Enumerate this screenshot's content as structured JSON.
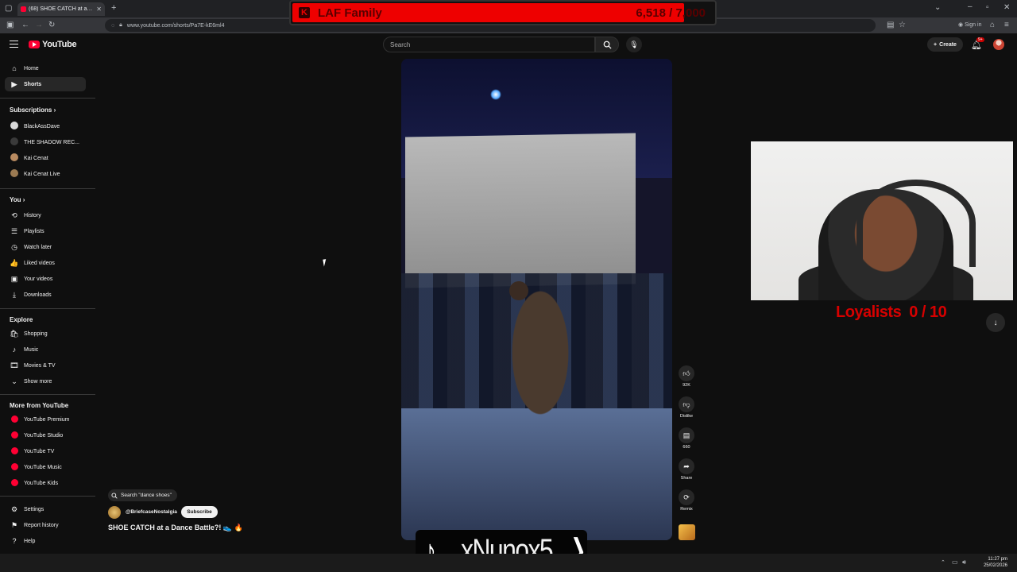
{
  "browser": {
    "tab_title": "(68) SHOE CATCH at a Dance",
    "url": "www.youtube.com/shorts/Pa7E-kE6ml4",
    "sign_in": "Sign in",
    "date": "25/02/2026",
    "time": "11:27 pm"
  },
  "overlay_goal": {
    "name": "LAF Family",
    "count": "6,518 / 7,000",
    "progress_fraction": 0.93
  },
  "header": {
    "logo_text": "YouTube",
    "search_placeholder": "Search",
    "create_label": "Create",
    "notification_badge": "9+"
  },
  "sidebar": {
    "top": [
      {
        "label": "Home",
        "icon": "home-icon",
        "glyph": "⌂"
      },
      {
        "label": "Shorts",
        "icon": "shorts-icon",
        "glyph": "▶",
        "active": true
      }
    ],
    "subscriptions_title": "Subscriptions",
    "subscriptions": [
      {
        "label": "BlackAssDave",
        "color": "#d9d9d9"
      },
      {
        "label": "THE SHADOW REC...",
        "color": "#3a3a3a"
      },
      {
        "label": "Kai Cenat",
        "color": "#b88a60"
      },
      {
        "label": "Kai Cenat Live",
        "color": "#9b7a52"
      }
    ],
    "you_title": "You",
    "you": [
      {
        "label": "History",
        "glyph": "⟲"
      },
      {
        "label": "Playlists",
        "glyph": "☰"
      },
      {
        "label": "Watch later",
        "glyph": "◷"
      },
      {
        "label": "Liked videos",
        "glyph": "👍"
      },
      {
        "label": "Your videos",
        "glyph": "▣"
      },
      {
        "label": "Downloads",
        "glyph": "⤓"
      }
    ],
    "explore_title": "Explore",
    "explore": [
      {
        "label": "Shopping",
        "glyph": "🛍"
      },
      {
        "label": "Music",
        "glyph": "♪"
      },
      {
        "label": "Movies & TV",
        "glyph": "🎞"
      },
      {
        "label": "Show more",
        "glyph": "⌄"
      }
    ],
    "more_title": "More from YouTube",
    "more": [
      {
        "label": "YouTube Premium"
      },
      {
        "label": "YouTube Studio"
      },
      {
        "label": "YouTube TV"
      },
      {
        "label": "YouTube Music"
      },
      {
        "label": "YouTube Kids"
      }
    ],
    "footer": [
      {
        "label": "Settings",
        "glyph": "⚙"
      },
      {
        "label": "Report history",
        "glyph": "⚑"
      },
      {
        "label": "Help",
        "glyph": "?"
      }
    ]
  },
  "short": {
    "search_chip": "Search \"dance shoes\"",
    "channel": "@BriefcaseNostalgia",
    "subscribe_label": "Subscribe",
    "title": "SHOE CATCH at a Dance Battle?! 👟 🔥",
    "actions": {
      "like_count": "92K",
      "dislike_label": "Dislike",
      "comments_count": "660",
      "share_label": "Share",
      "remix_label": "Remix"
    }
  },
  "stream_overlay": {
    "loyalists_label": "Loyalists",
    "loyalists_count": "0 / 10",
    "tiktok_name": "xNunox5"
  },
  "colors": {
    "bg": "#0f0f0f",
    "brand_red": "#ff0033",
    "goal_red": "#e00000",
    "loyalists_red": "#d60000"
  }
}
